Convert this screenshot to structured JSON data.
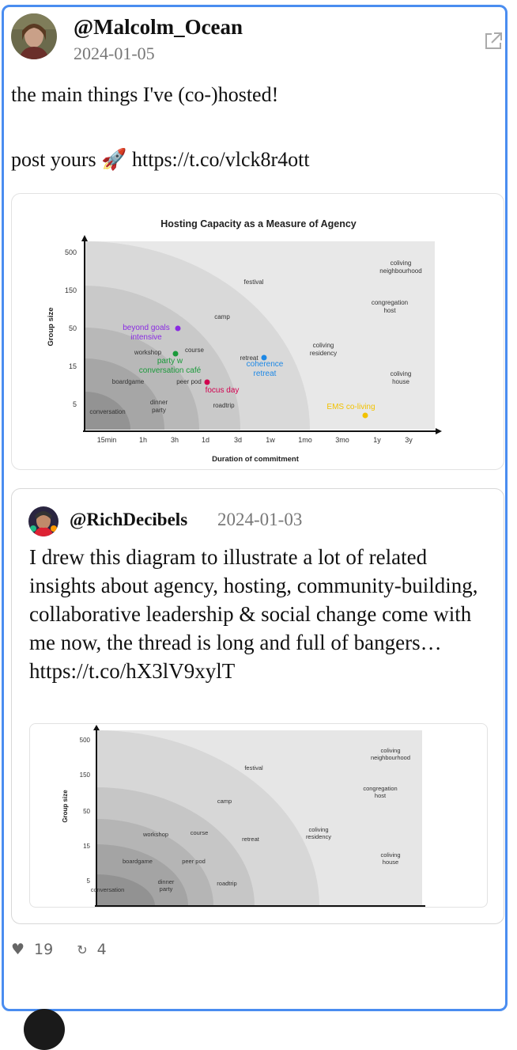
{
  "post": {
    "handle": "@Malcolm_Ocean",
    "date": "2024-01-05",
    "text": "the main things I've (co-)hosted!\n\npost yours 🚀 https://t.co/vlck8r4ott",
    "likes": "19",
    "retweets": "4"
  },
  "quote": {
    "handle": "@RichDecibels",
    "date": "2024-01-03",
    "text": "I drew this diagram to illustrate a lot of related insights about agency, hosting, community-building, collaborative leadership & social change come with me now, the thread is long and full of bangers… https://t.co/hX3lV9xylT"
  },
  "chart_data": [
    {
      "type": "scatter",
      "title": "Hosting Capacity as a Measure of Agency",
      "xlabel": "Duration of commitment",
      "ylabel": "Group size",
      "x_ticks": [
        "15min",
        "1h",
        "3h",
        "1d",
        "3d",
        "1w",
        "1mo",
        "3mo",
        "1y",
        "3y"
      ],
      "y_ticks": [
        "500",
        "150",
        "50",
        "15",
        "5"
      ],
      "labels": [
        {
          "text": "coliving neighbourhood"
        },
        {
          "text": "festival"
        },
        {
          "text": "congregation host"
        },
        {
          "text": "camp"
        },
        {
          "text": "coliving residency"
        },
        {
          "text": "workshop"
        },
        {
          "text": "course"
        },
        {
          "text": "retreat"
        },
        {
          "text": "coliving house"
        },
        {
          "text": "boardgame"
        },
        {
          "text": "peer pod"
        },
        {
          "text": "dinner party"
        },
        {
          "text": "roadtrip"
        },
        {
          "text": "conversation"
        }
      ],
      "points": [
        {
          "text": "beyond goals intensive",
          "color": "#8a2be2"
        },
        {
          "text": "party w conversation café",
          "color": "#1a9a3a"
        },
        {
          "text": "focus day",
          "color": "#d1004f"
        },
        {
          "text": "coherence retreat",
          "color": "#1e88e5"
        },
        {
          "text": "EMS co-living",
          "color": "#f2c200"
        }
      ]
    },
    {
      "type": "scatter",
      "ylabel": "Group size",
      "y_ticks": [
        "500",
        "150",
        "50",
        "15",
        "5"
      ],
      "labels": [
        {
          "text": "coliving neighbourhood"
        },
        {
          "text": "festival"
        },
        {
          "text": "congregation host"
        },
        {
          "text": "camp"
        },
        {
          "text": "coliving residency"
        },
        {
          "text": "workshop"
        },
        {
          "text": "course"
        },
        {
          "text": "retreat"
        },
        {
          "text": "coliving house"
        },
        {
          "text": "boardgame"
        },
        {
          "text": "peer pod"
        },
        {
          "text": "dinner party"
        },
        {
          "text": "roadtrip"
        },
        {
          "text": "conversation"
        }
      ]
    }
  ],
  "colors": {
    "accent_border": "#4a8df0",
    "muted_text": "#777777"
  }
}
